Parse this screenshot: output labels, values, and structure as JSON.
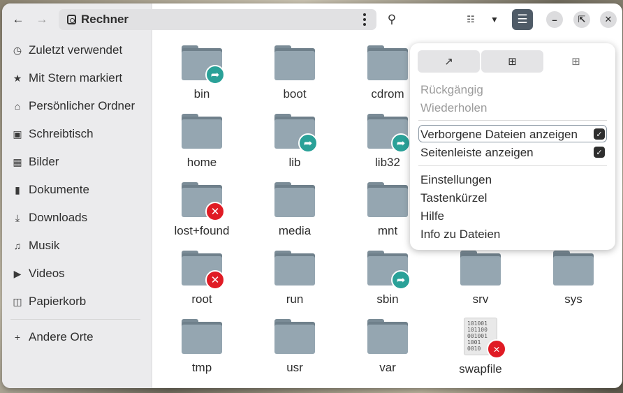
{
  "header": {
    "back_icon": "arrow-left-icon",
    "forward_icon": "arrow-right-icon",
    "location_title": "Rechner",
    "search_icon": "search-icon",
    "view_icon": "list-view-icon",
    "sort_icon": "chevron-down-icon",
    "menu_icon": "hamburger-menu-icon"
  },
  "sidebar": {
    "items": [
      {
        "label": "Zuletzt verwendet",
        "icon": "clock-icon"
      },
      {
        "label": "Mit Stern markiert",
        "icon": "star-icon"
      },
      {
        "label": "Persönlicher Ordner",
        "icon": "home-icon"
      },
      {
        "label": "Schreibtisch",
        "icon": "desktop-icon"
      },
      {
        "label": "Bilder",
        "icon": "image-icon"
      },
      {
        "label": "Dokumente",
        "icon": "document-icon"
      },
      {
        "label": "Downloads",
        "icon": "download-icon"
      },
      {
        "label": "Musik",
        "icon": "music-icon"
      },
      {
        "label": "Videos",
        "icon": "video-icon"
      },
      {
        "label": "Papierkorb",
        "icon": "trash-icon"
      }
    ],
    "other_places": {
      "label": "Andere Orte",
      "icon": "plus-icon"
    }
  },
  "files": [
    {
      "name": "bin",
      "badge": "link"
    },
    {
      "name": "boot",
      "badge": ""
    },
    {
      "name": "cdrom",
      "badge": ""
    },
    {
      "name": "home",
      "badge": ""
    },
    {
      "name": "lib",
      "badge": "link"
    },
    {
      "name": "lib32",
      "badge": "link"
    },
    {
      "name": "lost+found",
      "badge": "x"
    },
    {
      "name": "media",
      "badge": ""
    },
    {
      "name": "mnt",
      "badge": ""
    },
    {
      "name": "root",
      "badge": "x"
    },
    {
      "name": "run",
      "badge": ""
    },
    {
      "name": "sbin",
      "badge": "link"
    },
    {
      "name": "srv",
      "badge": ""
    },
    {
      "name": "sys",
      "badge": ""
    },
    {
      "name": "tmp",
      "badge": ""
    },
    {
      "name": "usr",
      "badge": ""
    },
    {
      "name": "var",
      "badge": ""
    },
    {
      "name": "swapfile",
      "badge": "x",
      "type": "binary"
    }
  ],
  "popover": {
    "top_buttons": [
      {
        "icon": "open-external-icon"
      },
      {
        "icon": "new-tab-icon"
      },
      {
        "icon": "new-folder-icon"
      }
    ],
    "undo": "Rückgängig",
    "redo": "Wiederholen",
    "show_hidden": "Verborgene Dateien anzeigen",
    "show_hidden_checked": true,
    "show_sidebar": "Seitenleiste anzeigen",
    "show_sidebar_checked": true,
    "preferences": "Einstellungen",
    "shortcuts": "Tastenkürzel",
    "help": "Hilfe",
    "about": "Info zu Dateien"
  },
  "binary_preview": [
    "101001",
    "101100",
    "001001",
    "1001",
    "0010"
  ]
}
